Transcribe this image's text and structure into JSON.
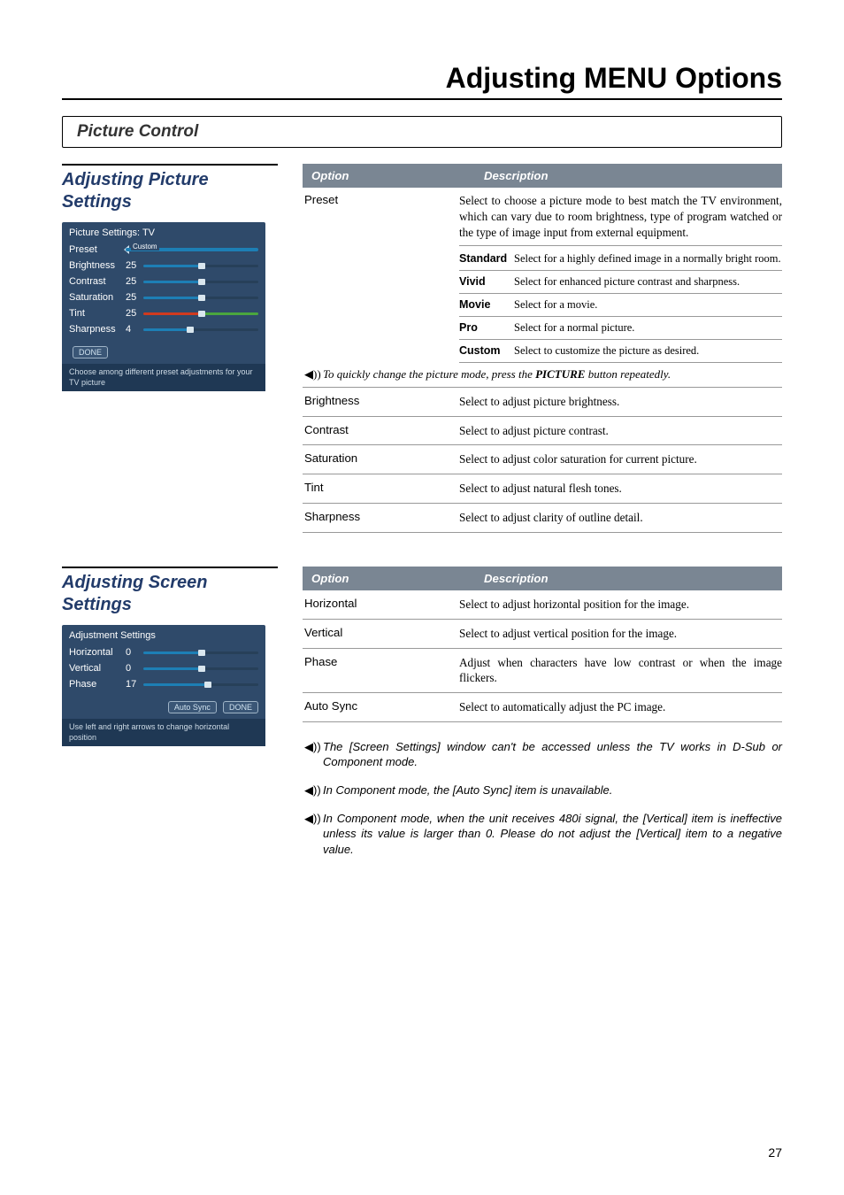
{
  "page_title": "Adjusting MENU Options",
  "subtitle": "Picture Control",
  "page_number": "27",
  "box1": {
    "heading": "Adjusting Picture Settings",
    "osd_title": "Picture Settings: TV",
    "preset_label": "Preset",
    "preset_value": "Custom",
    "rows": [
      {
        "label": "Brightness",
        "value": "25"
      },
      {
        "label": "Contrast",
        "value": "25"
      },
      {
        "label": "Saturation",
        "value": "25"
      },
      {
        "label": "Tint",
        "value": "25"
      },
      {
        "label": "Sharpness",
        "value": "4"
      }
    ],
    "btn_done": "DONE",
    "footer": "Choose among different preset adjustments for your TV picture"
  },
  "table1": {
    "hdr_option": "Option",
    "hdr_desc": "Description",
    "preset": {
      "name": "Preset",
      "desc": "Select to choose a picture mode to best match the TV environment, which can vary due to room brightness, type of program watched or the type of image input from external equipment.",
      "subopts": [
        {
          "name": "Standard",
          "desc": "Select for a highly defined image in a normally bright room."
        },
        {
          "name": "Vivid",
          "desc": "Select for enhanced picture contrast and sharpness."
        },
        {
          "name": "Movie",
          "desc": "Select for a movie."
        },
        {
          "name": "Pro",
          "desc": "Select for a normal picture."
        },
        {
          "name": "Custom",
          "desc": "Select to customize the picture as desired."
        }
      ],
      "note_pre": "To quickly change the picture mode, press the ",
      "note_bold": "PICTURE",
      "note_post": " button repeatedly."
    },
    "rows": [
      {
        "opt": "Brightness",
        "desc": "Select to adjust picture brightness."
      },
      {
        "opt": "Contrast",
        "desc": "Select to adjust picture contrast."
      },
      {
        "opt": "Saturation",
        "desc": "Select to adjust color saturation for current picture."
      },
      {
        "opt": "Tint",
        "desc": "Select to adjust natural flesh tones."
      },
      {
        "opt": "Sharpness",
        "desc": "Select to adjust clarity of outline detail."
      }
    ]
  },
  "box2": {
    "heading": "Adjusting Screen Settings",
    "osd_title": "Adjustment Settings",
    "rows": [
      {
        "label": "Horizontal",
        "value": "0"
      },
      {
        "label": "Vertical",
        "value": "0"
      },
      {
        "label": "Phase",
        "value": "17"
      }
    ],
    "btn_auto": "Auto Sync",
    "btn_done": "DONE",
    "footer": "Use left and right arrows to change horizontal position"
  },
  "table2": {
    "hdr_option": "Option",
    "hdr_desc": "Description",
    "rows": [
      {
        "opt": "Horizontal",
        "desc": "Select to adjust horizontal position for the image."
      },
      {
        "opt": "Vertical",
        "desc": "Select to adjust vertical position for the image."
      },
      {
        "opt": "Phase",
        "desc": "Adjust when characters have low contrast or when the image flickers."
      },
      {
        "opt": "Auto Sync",
        "desc": "Select to automatically adjust the PC image."
      }
    ]
  },
  "notes": [
    "The [Screen Settings] window can't be accessed unless the TV works in D-Sub or Component mode.",
    "In Component mode, the [Auto Sync] item is unavailable.",
    "In Component mode, when the unit receives 480i signal, the [Vertical] item is ineffective unless its value is larger than 0. Please do not adjust the [Vertical] item to a negative value."
  ],
  "icons": {
    "speaker": "◀))"
  }
}
